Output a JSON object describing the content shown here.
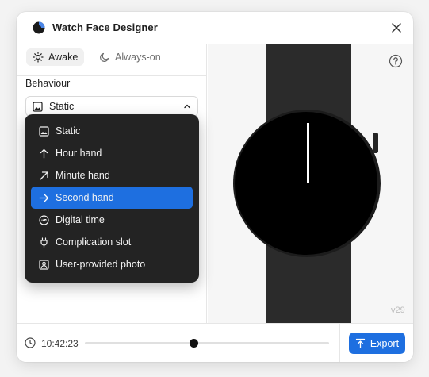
{
  "window": {
    "title": "Watch Face Designer"
  },
  "tabs": [
    {
      "label": "Awake",
      "active": true,
      "icon": "sun-icon"
    },
    {
      "label": "Always-on",
      "active": false,
      "icon": "moon-icon"
    }
  ],
  "behaviour": {
    "label": "Behaviour",
    "selected": "Static",
    "options": [
      {
        "label": "Static",
        "icon": "image-icon",
        "selected": false
      },
      {
        "label": "Hour hand",
        "icon": "arrow-up-icon",
        "selected": false
      },
      {
        "label": "Minute hand",
        "icon": "arrow-up-right-icon",
        "selected": false
      },
      {
        "label": "Second hand",
        "icon": "arrow-right-icon",
        "selected": true
      },
      {
        "label": "Digital time",
        "icon": "digital-time-icon",
        "selected": false
      },
      {
        "label": "Complication slot",
        "icon": "plug-icon",
        "selected": false
      },
      {
        "label": "User-provided photo",
        "icon": "portrait-icon",
        "selected": false
      }
    ]
  },
  "preview": {
    "version": "v29"
  },
  "timeline": {
    "time": "10:42:23",
    "position": 0.445
  },
  "export": {
    "label": "Export"
  },
  "colors": {
    "accent": "#1e6fe0",
    "dropdown_bg": "#232323",
    "strap": "#2b2b2b",
    "watch_face": "#000000"
  }
}
